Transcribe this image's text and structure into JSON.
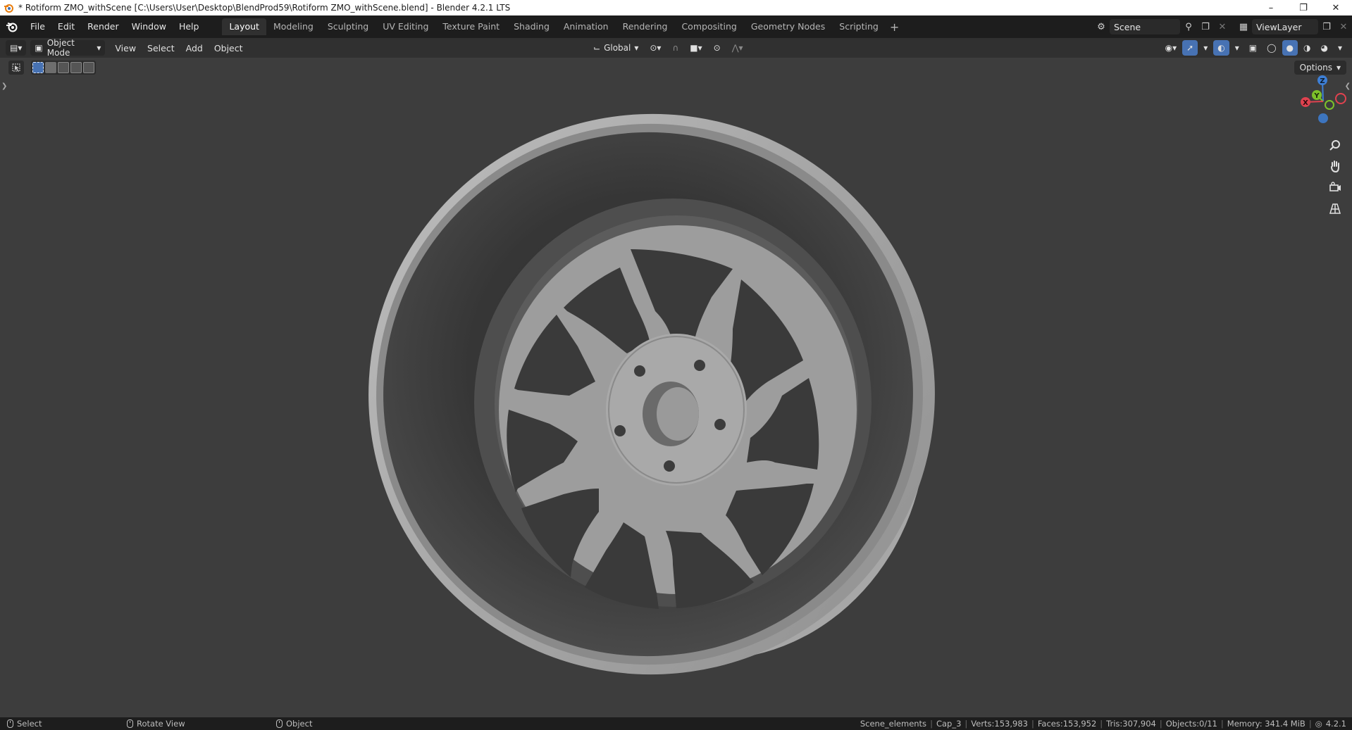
{
  "window": {
    "title": "* Rotiform ZMO_withScene [C:\\Users\\User\\Desktop\\BlendProd59\\Rotiform ZMO_withScene.blend] - Blender 4.2.1 LTS",
    "controls": [
      "minimize-icon",
      "restore-icon",
      "close-icon"
    ]
  },
  "menu": [
    "File",
    "Edit",
    "Render",
    "Window",
    "Help"
  ],
  "workspaces": [
    "Layout",
    "Modeling",
    "Sculpting",
    "UV Editing",
    "Texture Paint",
    "Shading",
    "Animation",
    "Rendering",
    "Compositing",
    "Geometry Nodes",
    "Scripting"
  ],
  "active_workspace": "Layout",
  "scene": {
    "name": "Scene",
    "view_layer": "ViewLayer"
  },
  "viewport_header": {
    "mode": "Object Mode",
    "menus": [
      "View",
      "Select",
      "Add",
      "Object"
    ],
    "orientation": "Global"
  },
  "viewport": {
    "options_label": "Options",
    "gizmo_axes": [
      "Z",
      "Y",
      "X"
    ],
    "axis_colors": {
      "x": "#e0424f",
      "y": "#7cc22a",
      "z": "#3d7fd6"
    }
  },
  "statusbar": {
    "hints": [
      {
        "icon": "mouse-left-icon",
        "label": "Select"
      },
      {
        "icon": "mouse-middle-icon",
        "label": "Rotate View"
      },
      {
        "icon": "mouse-right-icon",
        "label": "Object"
      }
    ],
    "stats": [
      "Scene_elements",
      "Cap_3",
      "Verts:153,983",
      "Faces:153,952",
      "Tris:307,904",
      "Objects:0/11",
      "Memory: 341.4 MiB"
    ],
    "version": "4.2.1"
  },
  "colors": {
    "accent": "#4772b3",
    "panel": "#303030",
    "viewport": "#3d3d3d"
  }
}
